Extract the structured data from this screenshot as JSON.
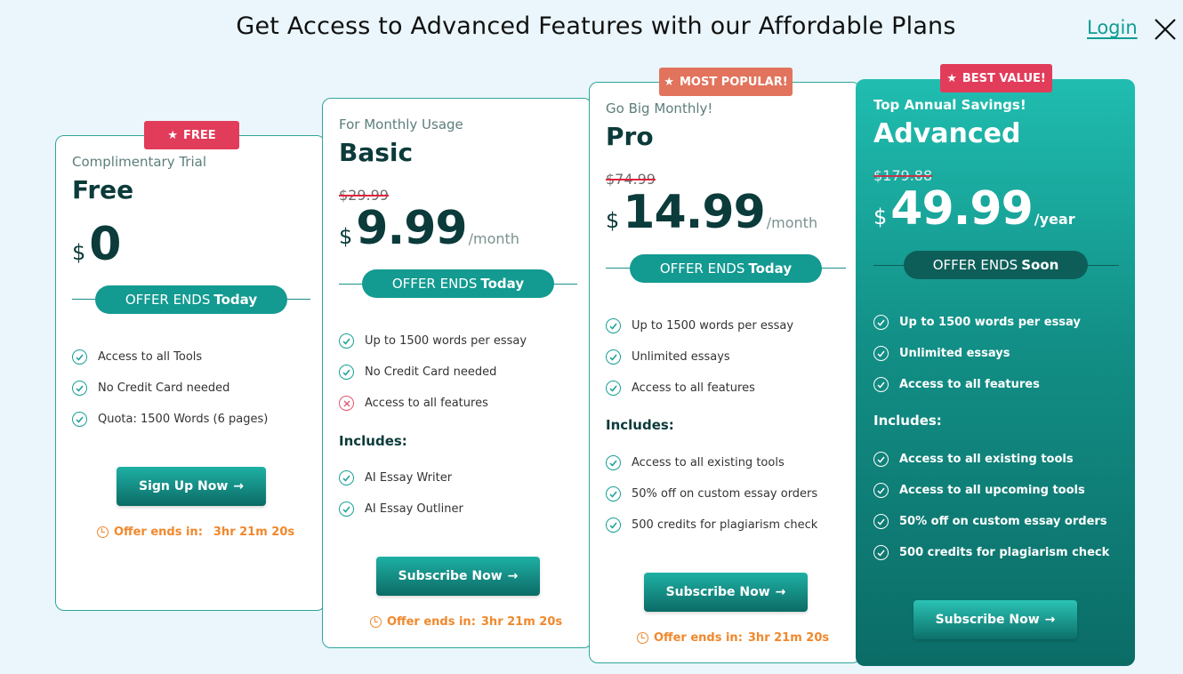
{
  "header": {
    "title": "Get Access to Advanced Features with our Affordable Plans",
    "login_label": "Login"
  },
  "colors": {
    "accent": "#139a91",
    "badge_red": "#e23c5b",
    "badge_orange": "#e2735c",
    "timer": "#f0882c",
    "dark_text": "#0b3b3a"
  },
  "icons": {
    "close": "close-icon",
    "check": "check-circle-icon",
    "cross": "x-circle-icon",
    "star": "star-icon",
    "clock": "clock-icon",
    "arrow": "arrow-right-icon"
  },
  "plans": [
    {
      "badge": "FREE",
      "subtitle": "Complimentary Trial",
      "name": "Free",
      "old_price": "",
      "currency": "$",
      "price": "0",
      "period": "",
      "offer_prefix": "OFFER ENDS",
      "offer_suffix": "Today",
      "features": [
        {
          "text": "Access to all Tools",
          "included": true
        },
        {
          "text": "No Credit Card needed",
          "included": true
        },
        {
          "text": "Quota: 1500 Words (6 pages)",
          "included": true
        }
      ],
      "includes_label": "",
      "includes": [],
      "button_label": "Sign Up Now",
      "timer_label": "Offer ends in:",
      "timer_value": "3hr 21m 20s"
    },
    {
      "badge": "",
      "subtitle": "For Monthly Usage",
      "name": "Basic",
      "old_price": "$29.99",
      "currency": "$",
      "price": "9.99",
      "period": "/month",
      "offer_prefix": "OFFER ENDS",
      "offer_suffix": "Today",
      "features": [
        {
          "text": "Up to 1500 words per essay",
          "included": true
        },
        {
          "text": "No Credit Card needed",
          "included": true
        },
        {
          "text": "Access to all features",
          "included": false
        }
      ],
      "includes_label": "Includes:",
      "includes": [
        "AI Essay Writer",
        "AI Essay Outliner"
      ],
      "button_label": "Subscribe Now",
      "timer_label": "Offer ends in:",
      "timer_value": "3hr 21m 20s"
    },
    {
      "badge": "MOST POPULAR!",
      "subtitle": "Go Big Monthly!",
      "name": "Pro",
      "old_price": "$74.99",
      "currency": "$",
      "price": "14.99",
      "period": "/month",
      "offer_prefix": "OFFER ENDS",
      "offer_suffix": "Today",
      "features": [
        {
          "text": "Up to 1500 words per essay",
          "included": true
        },
        {
          "text": "Unlimited essays",
          "included": true
        },
        {
          "text": "Access to all features",
          "included": true
        }
      ],
      "includes_label": "Includes:",
      "includes": [
        "Access to all existing tools",
        "50% off on custom essay orders",
        "500 credits for plagiarism check"
      ],
      "button_label": "Subscribe Now",
      "timer_label": "Offer ends in:",
      "timer_value": "3hr 21m 20s"
    },
    {
      "badge": "BEST VALUE!",
      "subtitle": "Top Annual Savings!",
      "name": "Advanced",
      "old_price": "$179.88",
      "currency": "$",
      "price": "49.99",
      "period": "/year",
      "offer_prefix": "OFFER ENDS",
      "offer_suffix": "Soon",
      "features": [
        {
          "text": "Up to 1500 words per essay",
          "included": true
        },
        {
          "text": "Unlimited essays",
          "included": true
        },
        {
          "text": "Access to all features",
          "included": true
        }
      ],
      "includes_label": "Includes:",
      "includes": [
        "Access to all existing tools",
        "Access to all upcoming tools",
        "50% off on custom essay orders",
        "500 credits for plagiarism check"
      ],
      "button_label": "Subscribe Now",
      "timer_label": "",
      "timer_value": ""
    }
  ]
}
